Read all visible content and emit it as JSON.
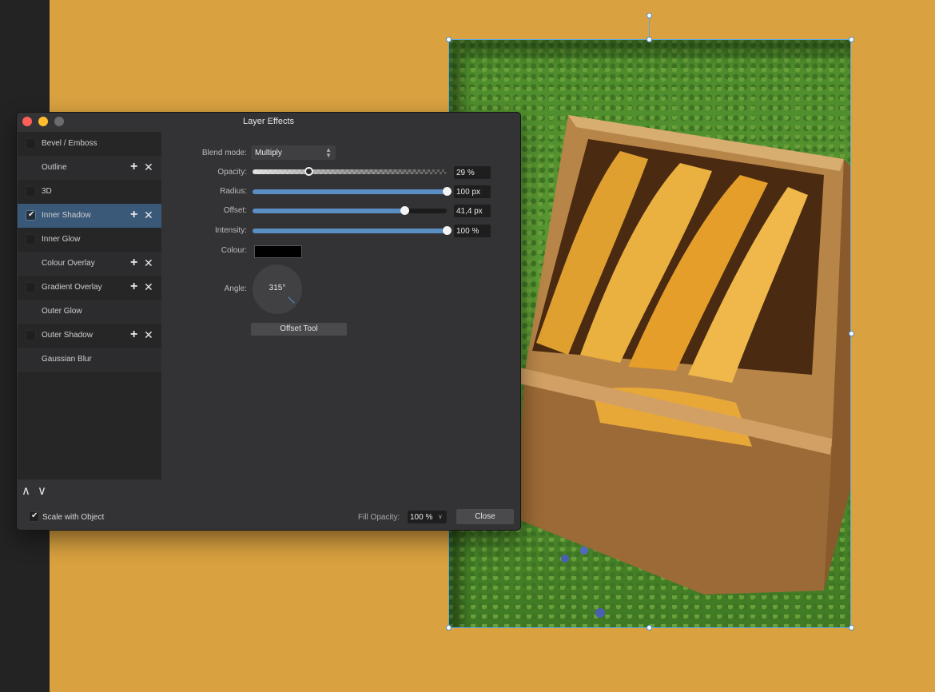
{
  "dialog": {
    "title": "Layer Effects",
    "effects": [
      {
        "label": "Bevel / Emboss",
        "checked": false,
        "has_controls": false
      },
      {
        "label": "Outline",
        "checked": false,
        "has_controls": true
      },
      {
        "label": "3D",
        "checked": false,
        "has_controls": false
      },
      {
        "label": "Inner Shadow",
        "checked": true,
        "has_controls": true,
        "selected": true
      },
      {
        "label": "Inner Glow",
        "checked": false,
        "has_controls": false
      },
      {
        "label": "Colour Overlay",
        "checked": false,
        "has_controls": true
      },
      {
        "label": "Gradient Overlay",
        "checked": false,
        "has_controls": true
      },
      {
        "label": "Outer Glow",
        "checked": false,
        "has_controls": false
      },
      {
        "label": "Outer Shadow",
        "checked": false,
        "has_controls": true
      },
      {
        "label": "Gaussian Blur",
        "checked": false,
        "has_controls": false
      }
    ],
    "blend_mode_label": "Blend mode:",
    "blend_mode_value": "Multiply",
    "opacity_label": "Opacity:",
    "opacity_value": "29 %",
    "opacity_level": 0.29,
    "radius_label": "Radius:",
    "radius_value": "100 px",
    "radius_level": 1.0,
    "offset_label": "Offset:",
    "offset_value": "41,4 px",
    "offset_level": 0.78,
    "intensity_label": "Intensity:",
    "intensity_value": "100 %",
    "intensity_level": 1.0,
    "colour_label": "Colour:",
    "colour_value": "#000000",
    "angle_label": "Angle:",
    "angle_value": "315°",
    "offset_tool_label": "Offset Tool",
    "scale_with_object_label": "Scale with Object",
    "scale_with_object_checked": true,
    "fill_opacity_label": "Fill Opacity:",
    "fill_opacity_value": "100 %",
    "close_label": "Close"
  },
  "colors": {
    "canvas_background": "#d9a13f",
    "selection_accent": "#5aa9e6",
    "slider_accent": "#5b8fc4",
    "selected_row": "#3a5878"
  }
}
